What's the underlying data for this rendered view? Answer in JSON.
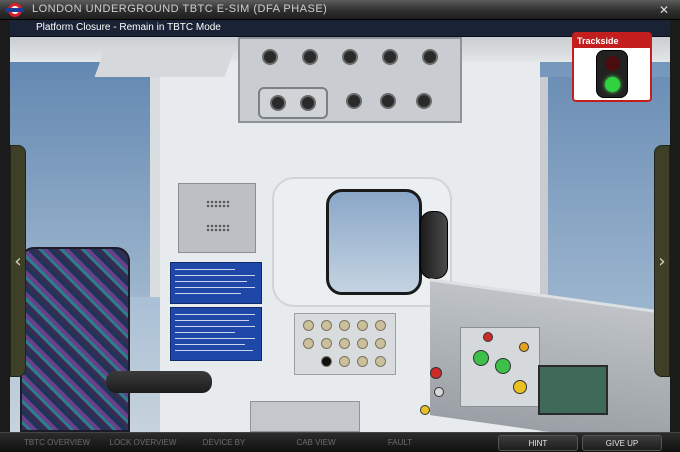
{
  "window": {
    "title": "LONDON UNDERGROUND TBTC E-SIM (DFA PHASE)",
    "close_symbol": "✕"
  },
  "scenario": {
    "title": "Platform Closure - Remain in TBTC Mode"
  },
  "trackside": {
    "label": "Trackside",
    "signal_aspect": "green",
    "colors": {
      "header": "#c31e1e",
      "green": "#2fd33f",
      "red_off": "#4a0c0c"
    }
  },
  "nav": {
    "left_symbol": "‹",
    "right_symbol": "›"
  },
  "toolbar": {
    "items": [
      {
        "label": "TBTC OVERVIEW",
        "enabled": false
      },
      {
        "label": "LOCK OVERVIEW",
        "enabled": false
      },
      {
        "label": "DEVICE BY",
        "enabled": false
      },
      {
        "label": "CAB VIEW",
        "enabled": false
      },
      {
        "label": "FAULT",
        "enabled": false
      },
      {
        "label": "HINT",
        "enabled": true
      },
      {
        "label": "GIVE UP",
        "enabled": true
      }
    ]
  }
}
